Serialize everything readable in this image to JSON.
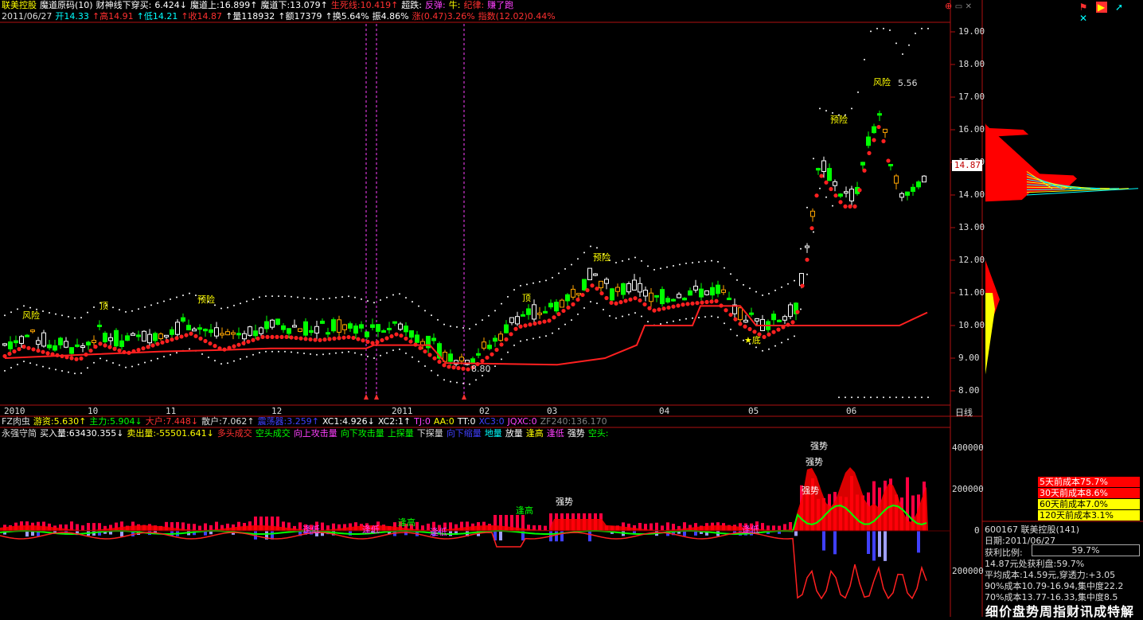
{
  "header": {
    "row1": [
      {
        "t": "联美控股",
        "c": "#ffff00"
      },
      {
        "t": "魔道原码(10)",
        "c": "#ffffff"
      },
      {
        "t": "财神线下穿买:",
        "c": "#ffffff"
      },
      {
        "t": "6.424↓",
        "c": "#ffffff"
      },
      {
        "t": "魔道上:16.899↑",
        "c": "#ffffff"
      },
      {
        "t": "魔道下:13.079↑",
        "c": "#ffffff"
      },
      {
        "t": "生死线:10.419↑",
        "c": "#ff3030"
      },
      {
        "t": "超跌:",
        "c": "#ffffff"
      },
      {
        "t": "反弹:",
        "c": "#ff40ff"
      },
      {
        "t": "牛:",
        "c": "#ffff00"
      },
      {
        "t": "纪律:",
        "c": "#ff3030"
      },
      {
        "t": "赚了跑",
        "c": "#ff40ff"
      }
    ],
    "row2": [
      {
        "t": "2011/06/27",
        "c": "#dddddd"
      },
      {
        "t": "开14.33",
        "c": "#00ffff"
      },
      {
        "t": "↑高14.91",
        "c": "#ff3030"
      },
      {
        "t": "↑低14.21",
        "c": "#00ffff"
      },
      {
        "t": "↑收14.87",
        "c": "#ff3030"
      },
      {
        "t": "↑量118932",
        "c": "#ffffff"
      },
      {
        "t": "↑额17379",
        "c": "#ffffff"
      },
      {
        "t": "↑换5.64%",
        "c": "#ffffff"
      },
      {
        "t": "振4.86%",
        "c": "#ffffff"
      },
      {
        "t": "涨(0.47)3.26%",
        "c": "#ff3030"
      },
      {
        "t": "指数(12.02)0.44%",
        "c": "#ff3030"
      }
    ],
    "row3": [
      {
        "t": "FZ肉虫",
        "c": "#dddddd"
      },
      {
        "t": "游资:5.630↑",
        "c": "#ffff00"
      },
      {
        "t": "主力:5.904↓",
        "c": "#00ff00"
      },
      {
        "t": "大户:7.448↓",
        "c": "#ff3030"
      },
      {
        "t": "散户:7.062↑",
        "c": "#dddddd"
      },
      {
        "t": "震荡器:3.259↑",
        "c": "#4040ff"
      },
      {
        "t": "XC1:4.926↓",
        "c": "#ffffff"
      },
      {
        "t": "XC2:1↑",
        "c": "#ffffff"
      },
      {
        "t": "TJ:0",
        "c": "#ff40ff"
      },
      {
        "t": "AA:0",
        "c": "#ffff00"
      },
      {
        "t": "TT:0",
        "c": "#ffffff"
      },
      {
        "t": "XC3:0",
        "c": "#4040ff"
      },
      {
        "t": "JQXC:0",
        "c": "#ff40ff"
      },
      {
        "t": "ZF240:136.170",
        "c": "#808080"
      }
    ],
    "row4": [
      {
        "t": "永强守简",
        "c": "#dddddd"
      },
      {
        "t": "买入量:63430.355↓",
        "c": "#ffffff"
      },
      {
        "t": "卖出量:-55501.641↓",
        "c": "#ffff00"
      },
      {
        "t": "多头成交",
        "c": "#ff3030"
      },
      {
        "t": "空头成交",
        "c": "#00ff00"
      },
      {
        "t": "向上攻击量",
        "c": "#ff40ff"
      },
      {
        "t": "向下攻击量",
        "c": "#00ff00"
      },
      {
        "t": "上探量",
        "c": "#00ff00"
      },
      {
        "t": "下探量",
        "c": "#dddddd"
      },
      {
        "t": "向下缩量",
        "c": "#4040ff"
      },
      {
        "t": "地量",
        "c": "#00ffff"
      },
      {
        "t": "放量",
        "c": "#ffffff"
      },
      {
        "t": "逢高",
        "c": "#ffff00"
      },
      {
        "t": "逢低",
        "c": "#ff40ff"
      },
      {
        "t": "强势",
        "c": "#ffffff"
      },
      {
        "t": "空头:",
        "c": "#00ff00"
      }
    ]
  },
  "price_axis": [
    "19.00",
    "18.00",
    "17.00",
    "16.00",
    "15.00",
    "14.00",
    "13.00",
    "12.00",
    "11.00",
    "10.00",
    "9.00",
    "8.00"
  ],
  "current_price": "14.87",
  "vol_axis": [
    "400000",
    "200000",
    "0",
    "200000"
  ],
  "time_axis": [
    "2010",
    "10",
    "11",
    "12",
    "2011",
    "02",
    "03",
    "04",
    "05",
    "06"
  ],
  "period_label": "日线",
  "annotations": {
    "risk1": "风险",
    "top1": "顶",
    "dz1": "预险",
    "top2": "顶",
    "dz2": "预险",
    "dz3": "预险",
    "risk2": "风险",
    "risk_val": "5.56",
    "low_val": "8.80",
    "bottom": "★底",
    "strong1": "强势",
    "strong2": "强势",
    "strong3": "强势",
    "strong4": "强势",
    "high1": "逢高",
    "high2": "逢高",
    "low1": "逢低",
    "low2": "逢低",
    "low3": "逢低",
    "low4": "逢低"
  },
  "cost_legend": [
    {
      "t": "5天前成本75.7%",
      "bg": "#ff0000",
      "fg": "#ffffff"
    },
    {
      "t": "30天前成本8.6%",
      "bg": "#ff0000",
      "fg": "#ffffff"
    },
    {
      "t": "60天前成本7.0%",
      "bg": "#ffff00",
      "fg": "#000000"
    },
    {
      "t": "120天前成本3.1%",
      "bg": "#ffff00",
      "fg": "#000000"
    }
  ],
  "info": {
    "code_line": "600167 联美控股(141)",
    "date": "日期:2011/06/27",
    "profit_label": "获利比例:",
    "profit_value": "59.7%",
    "line1": "14.87元处获利盘:59.7%",
    "line2": "平均成本:14.59元,穿透力:+3.05",
    "line3": "90%成本10.79-16.94,集中度22.2",
    "line4": "70%成本13.77-16.33,集中度8.5"
  },
  "footer_brand": "细价盘势周指财讯成特解",
  "colors": {
    "up": "#ff3030",
    "down": "#00ff00",
    "axis": "#b01010",
    "dot": "#ffffff"
  },
  "toolbar": [
    "flag-icon",
    "triangle-icon",
    "arrow-icon",
    "cross-icon"
  ]
}
